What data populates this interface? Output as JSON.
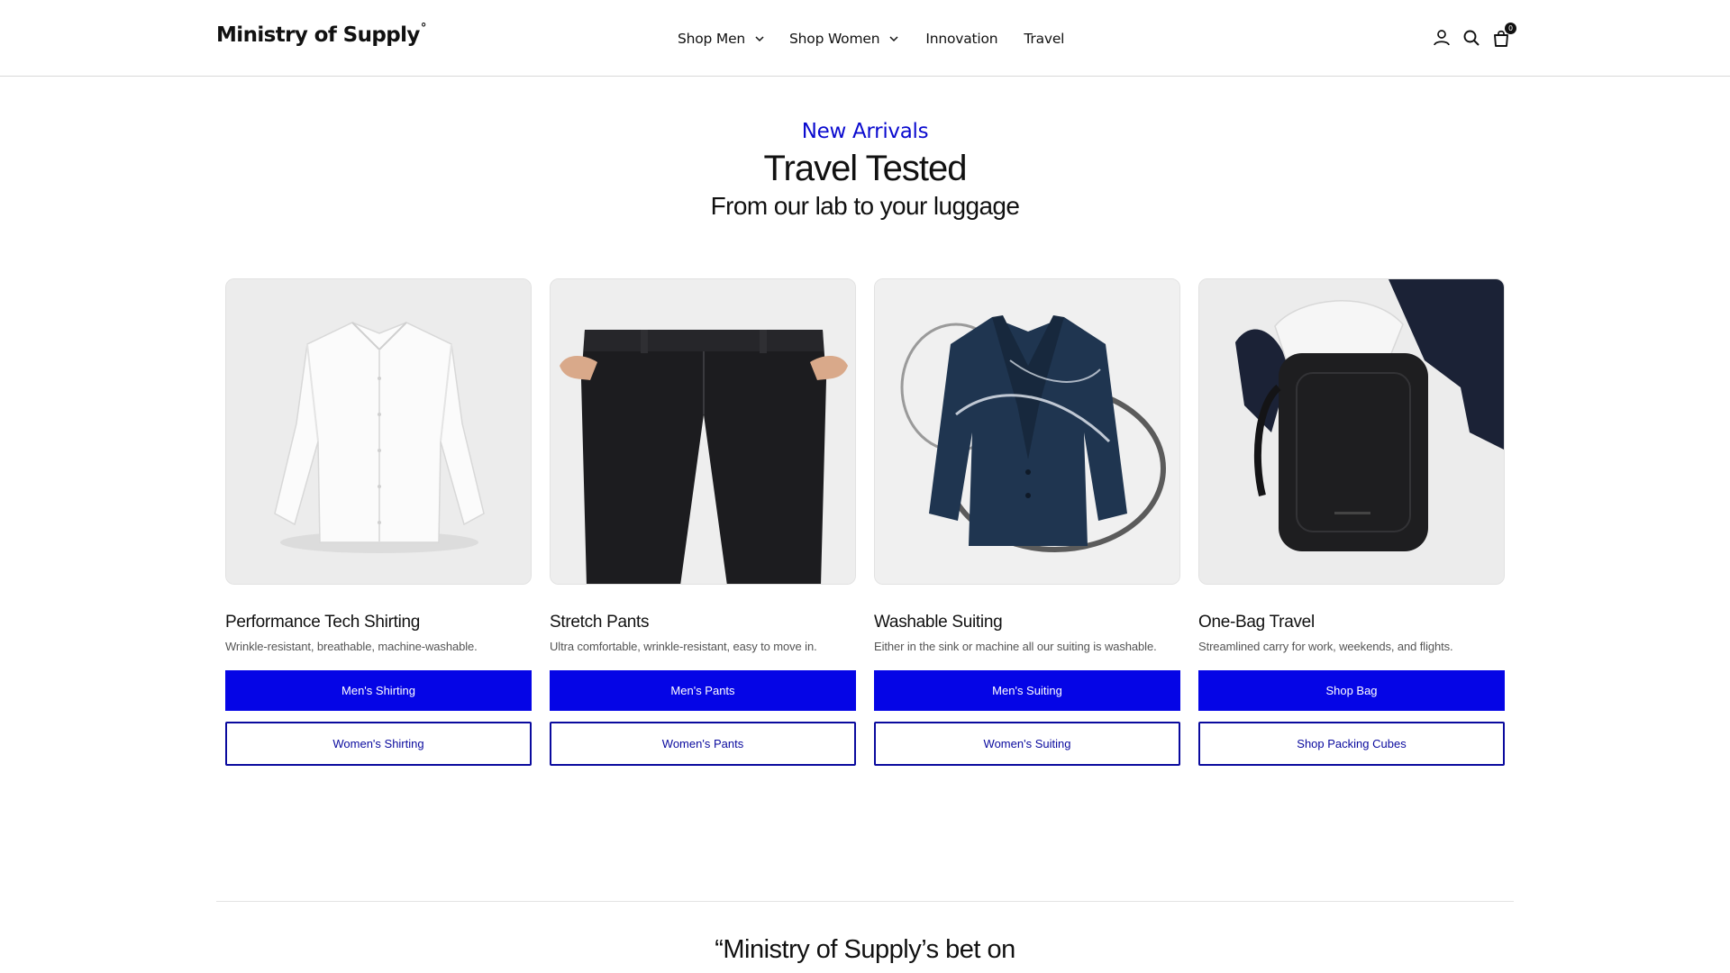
{
  "header": {
    "logo": "Ministry of Supply",
    "logo_mark": "°",
    "nav": [
      {
        "label": "Shop Men",
        "has_dropdown": true
      },
      {
        "label": "Shop Women",
        "has_dropdown": true
      },
      {
        "label": "Innovation",
        "has_dropdown": false
      },
      {
        "label": "Travel",
        "has_dropdown": false
      }
    ],
    "icons": [
      "account-icon",
      "search-icon",
      "cart-icon"
    ],
    "cart_count": "0"
  },
  "hero": {
    "eyebrow": "New Arrivals",
    "title": "Travel Tested",
    "subtitle": "From our lab to your luggage"
  },
  "cards": [
    {
      "title": "Performance Tech Shirting",
      "description": "Wrinkle-resistant, breathable, machine-washable.",
      "primary_button": "Men's Shirting",
      "secondary_button": "Women's Shirting",
      "image": "white-dress-shirt"
    },
    {
      "title": "Stretch Pants",
      "description": "Ultra comfortable, wrinkle-resistant, easy to move in.",
      "primary_button": "Men's Pants",
      "secondary_button": "Women's Pants",
      "image": "black-stretch-pants"
    },
    {
      "title": "Washable Suiting",
      "description": "Either in the sink or machine all our suiting is washable.",
      "primary_button": "Men's Suiting",
      "secondary_button": "Women's Suiting",
      "image": "navy-blazer-water-splash"
    },
    {
      "title": "One-Bag Travel",
      "description": "Streamlined carry for work, weekends, and flights.",
      "primary_button": "Shop Bag",
      "secondary_button": "Shop Packing Cubes",
      "image": "black-backpack-with-clothes"
    }
  ],
  "quote": {
    "text": "“Ministry of Supply’s bet on"
  },
  "colors": {
    "accent": "#0505e6",
    "accent_dark": "#0a0a9e",
    "text": "#111111",
    "muted": "#555555"
  }
}
